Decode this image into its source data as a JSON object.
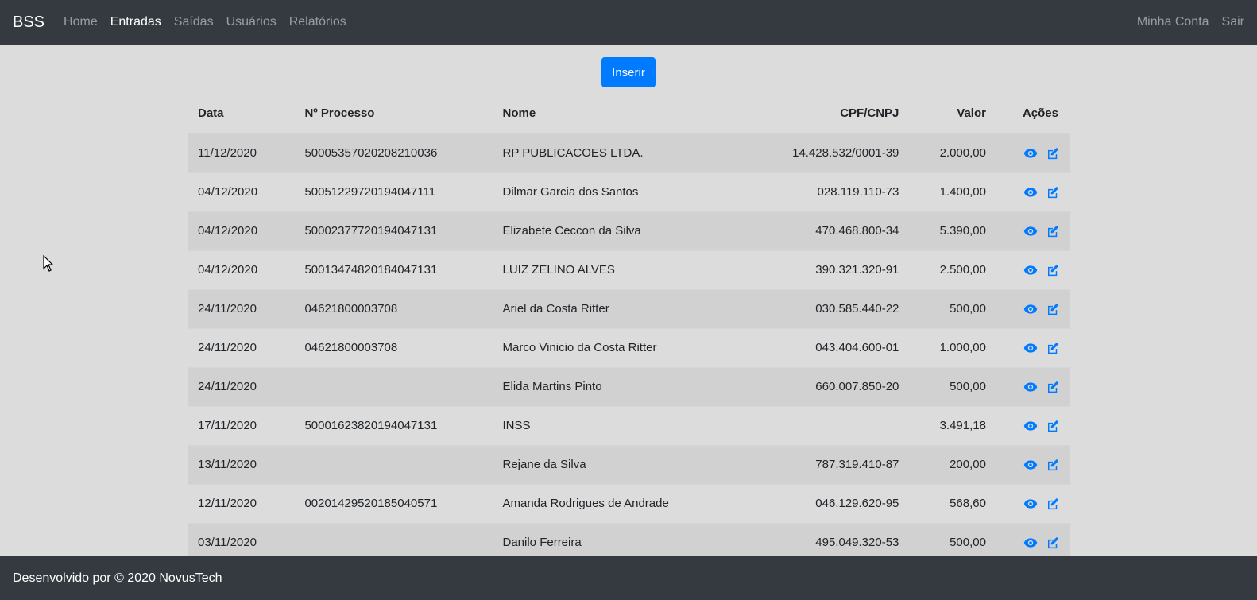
{
  "navbar": {
    "brand": "BSS",
    "links": [
      {
        "label": "Home",
        "active": false
      },
      {
        "label": "Entradas",
        "active": true
      },
      {
        "label": "Saídas",
        "active": false
      },
      {
        "label": "Usuários",
        "active": false
      },
      {
        "label": "Relatórios",
        "active": false
      }
    ],
    "account": "Minha Conta",
    "logout": "Sair"
  },
  "actions": {
    "insert_label": "Inserir"
  },
  "table": {
    "headers": [
      "Data",
      "Nº Processo",
      "Nome",
      "CPF/CNPJ",
      "Valor",
      "Ações"
    ],
    "rows": [
      {
        "data": "11/12/2020",
        "processo": "50005357020208210036",
        "nome": "RP PUBLICACOES LTDA.",
        "cpf": "14.428.532/0001-39",
        "valor": "2.000,00"
      },
      {
        "data": "04/12/2020",
        "processo": "50051229720194047111",
        "nome": "Dilmar Garcia dos Santos",
        "cpf": "028.119.110-73",
        "valor": "1.400,00"
      },
      {
        "data": "04/12/2020",
        "processo": "50002377720194047131",
        "nome": "Elizabete Ceccon da Silva",
        "cpf": "470.468.800-34",
        "valor": "5.390,00"
      },
      {
        "data": "04/12/2020",
        "processo": "50013474820184047131",
        "nome": "LUIZ ZELINO ALVES",
        "cpf": "390.321.320-91",
        "valor": "2.500,00"
      },
      {
        "data": "24/11/2020",
        "processo": "04621800003708",
        "nome": "Ariel da Costa Ritter",
        "cpf": "030.585.440-22",
        "valor": "500,00"
      },
      {
        "data": "24/11/2020",
        "processo": "04621800003708",
        "nome": "Marco Vinicio da Costa Ritter",
        "cpf": "043.404.600-01",
        "valor": "1.000,00"
      },
      {
        "data": "24/11/2020",
        "processo": "",
        "nome": "Elida Martins Pinto",
        "cpf": "660.007.850-20",
        "valor": "500,00"
      },
      {
        "data": "17/11/2020",
        "processo": "50001623820194047131",
        "nome": "INSS",
        "cpf": "",
        "valor": "3.491,18"
      },
      {
        "data": "13/11/2020",
        "processo": "",
        "nome": "Rejane da Silva",
        "cpf": "787.319.410-87",
        "valor": "200,00"
      },
      {
        "data": "12/11/2020",
        "processo": "00201429520185040571",
        "nome": "Amanda Rodrigues de Andrade",
        "cpf": "046.129.620-95",
        "valor": "568,60"
      },
      {
        "data": "03/11/2020",
        "processo": "",
        "nome": "Danilo Ferreira",
        "cpf": "495.049.320-53",
        "valor": "500,00"
      }
    ]
  },
  "icons": {
    "view": "eye-icon",
    "edit": "edit-icon",
    "accent": "#007bff"
  },
  "footer": {
    "text": "Desenvolvido por © 2020 NovusTech"
  }
}
